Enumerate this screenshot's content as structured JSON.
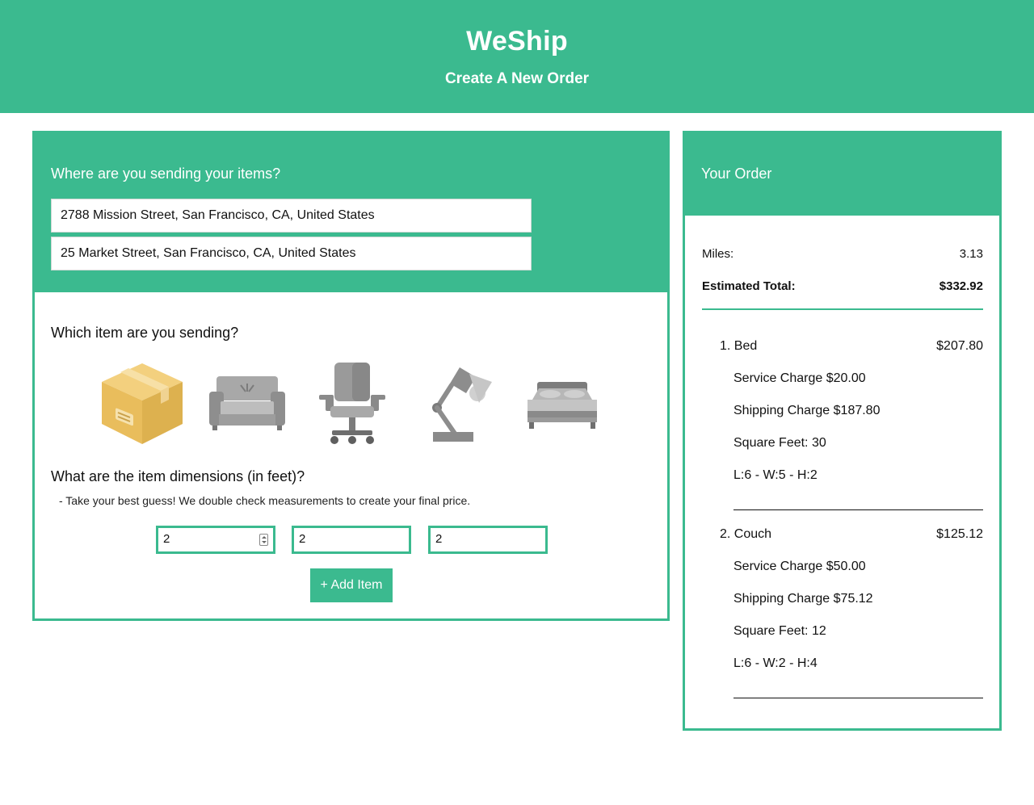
{
  "header": {
    "brand": "WeShip",
    "subtitle": "Create A New Order"
  },
  "destination": {
    "question": "Where are you sending your items?",
    "from_address": "2788 Mission Street, San Francisco, CA, United States",
    "to_address": "25 Market Street, San Francisco, CA, United States"
  },
  "item_select": {
    "question": "Which item are you sending?",
    "items": [
      {
        "icon": "box-icon"
      },
      {
        "icon": "couch-icon"
      },
      {
        "icon": "office-chair-icon"
      },
      {
        "icon": "desk-lamp-icon"
      },
      {
        "icon": "bed-icon"
      }
    ]
  },
  "dimensions": {
    "question": "What are the item dimensions (in feet)?",
    "hint": "- Take your best guess! We double check measurements to create your final price.",
    "length": "2",
    "width": "2",
    "height": "2"
  },
  "add_button": "+ Add Item",
  "order": {
    "title": "Your Order",
    "miles_label": "Miles:",
    "miles_value": "3.13",
    "total_label": "Estimated Total:",
    "total_value": "$332.92",
    "items": [
      {
        "name": "1. Bed",
        "price": "$207.80",
        "service": "Service Charge $20.00",
        "shipping": "Shipping Charge $187.80",
        "sqft": "Square Feet: 30",
        "dims": "L:6 - W:5 - H:2"
      },
      {
        "name": "2. Couch",
        "price": "$125.12",
        "service": "Service Charge $50.00",
        "shipping": "Shipping Charge $75.12",
        "sqft": "Square Feet: 12",
        "dims": "L:6 - W:2 - H:4"
      }
    ]
  },
  "colors": {
    "accent": "#3bba8f",
    "box": "#e9c46a",
    "icon_gray": "#9b9b9b"
  }
}
